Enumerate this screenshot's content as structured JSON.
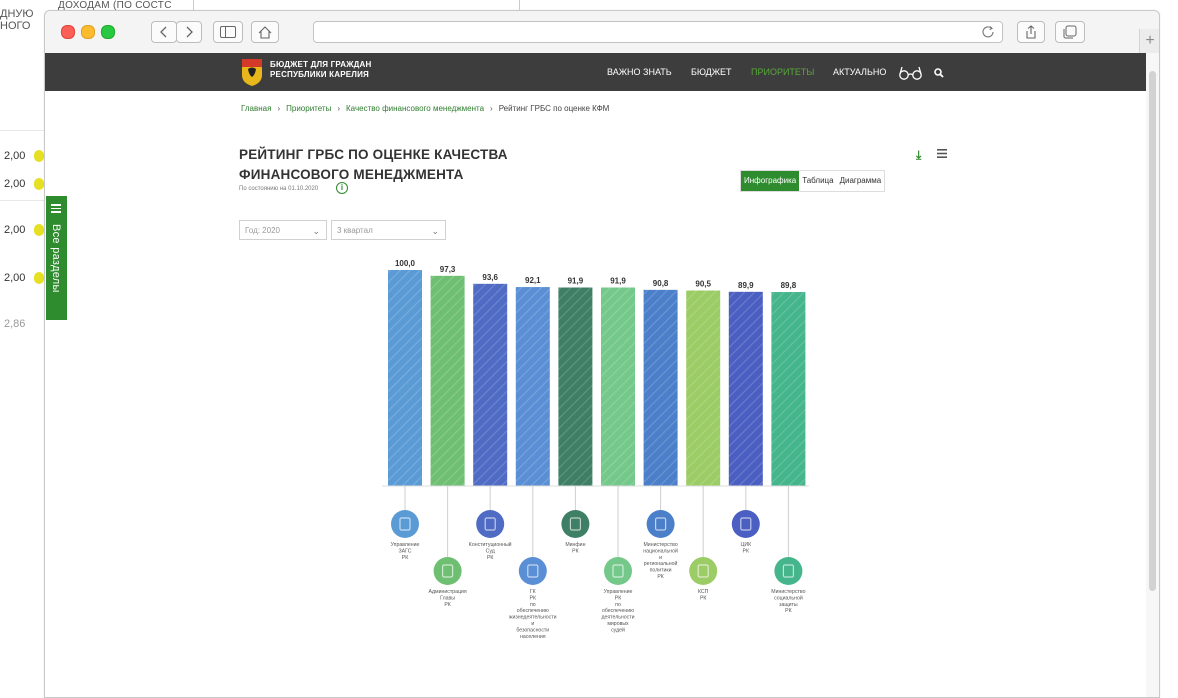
{
  "background": {
    "top_caption": "ДОХОДАМ (ПО СОСТС",
    "left_caption": "ДНУЮ\nНОГО",
    "values": [
      "2,00",
      "2,00",
      "2,00",
      "2,00",
      "2,86"
    ]
  },
  "colors": {
    "header_bg": "#3d3d3d",
    "accent_green": "#2e8b2e",
    "bar_palette": [
      "#5b9bd5",
      "#6fbf73",
      "#4f6bc4",
      "#5a8fd6",
      "#3e7f65",
      "#74c98a",
      "#4b7fc9",
      "#9ccc65",
      "#4a5fc1",
      "#45b58c"
    ]
  },
  "site": {
    "brand_line1": "БЮДЖЕТ ДЛЯ ГРАЖДАН",
    "brand_line2": "РЕСПУБЛИКИ КАРЕЛИЯ",
    "nav": [
      "ВАЖНО ЗНАТЬ",
      "БЮДЖЕТ",
      "ПРИОРИТЕТЫ",
      "АКТУАЛЬНО"
    ],
    "nav_active_index": 2
  },
  "breadcrumb": [
    "Главная",
    "Приоритеты",
    "Качество финансового менеджмента",
    "Рейтинг ГРБС по оценке КФМ"
  ],
  "page": {
    "title_line1": "РЕЙТИНГ ГРБС ПО ОЦЕНКЕ КАЧЕСТВА",
    "title_line2": "ФИНАНСОВОГО МЕНЕДЖМЕНТА",
    "as_of": "По состоянию на 01.10.2020",
    "tabs": [
      "Инфографика",
      "Таблица",
      "Диаграмма"
    ],
    "active_tab": "Инфографика",
    "year_select": "Год: 2020",
    "quarter_select": "3 квартал"
  },
  "side_tab": {
    "label": "Все разделы"
  },
  "chart_data": {
    "type": "bar",
    "categories": [
      "Управление ЗАГС РК",
      "Администрация Главы РК",
      "Конституционный Суд РК",
      "ГК РК по обеспечению жизнедеятельности и безопасности населения",
      "Минфин РК",
      "Управление РК по обеспечению деятельности мировых судей",
      "Министерство национальной и региональной политики РК",
      "КСП РК",
      "ЦИК РК",
      "Министерство социальной защиты РК"
    ],
    "label_below": [
      true,
      false,
      true,
      false,
      true,
      false,
      true,
      false,
      true,
      false
    ],
    "values": [
      100.0,
      97.3,
      93.6,
      92.1,
      91.9,
      91.9,
      90.8,
      90.5,
      89.9,
      89.8
    ],
    "value_labels": [
      "100,0",
      "97,3",
      "93,6",
      "92,1",
      "91,9",
      "91,9",
      "90,8",
      "90,5",
      "89,9",
      "89,8"
    ]
  }
}
